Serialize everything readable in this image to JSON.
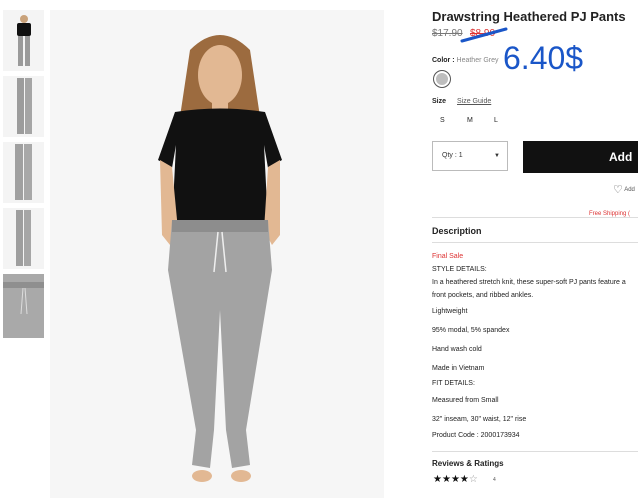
{
  "product": {
    "title": "Drawstring Heathered PJ Pants",
    "old_price": "$17.90",
    "sale_price": "$8.90",
    "handwritten_price": "6.40$",
    "color_label": "Color :",
    "color_value": "Heather Grey",
    "size_label": "Size",
    "size_guide": "Size Guide",
    "sizes": [
      "S",
      "M",
      "L"
    ],
    "qty": "Qty : 1",
    "add_button": "Add",
    "wishlist": "Add",
    "free_shipping": "Free Shipping ("
  },
  "description": {
    "heading": "Description",
    "final_sale": "Final Sale",
    "lines": [
      "STYLE DETAILS:",
      "In a heathered stretch knit, these super-soft PJ pants feature a",
      "front pockets, and ribbed ankles.",
      "Lightweight",
      "95% modal, 5% spandex",
      "Hand wash cold",
      "Made in Vietnam",
      "FIT DETAILS:",
      "Measured from Small",
      "32\" inseam, 30\" waist, 12\" rise",
      "Product Code : 2000173934"
    ]
  },
  "reviews": {
    "heading": "Reviews & Ratings",
    "rating": 4,
    "max": 5,
    "count": "4"
  },
  "colors": {
    "sale_red": "#d33333",
    "handwriting_blue": "#1a56c8",
    "button_black": "#111111"
  }
}
